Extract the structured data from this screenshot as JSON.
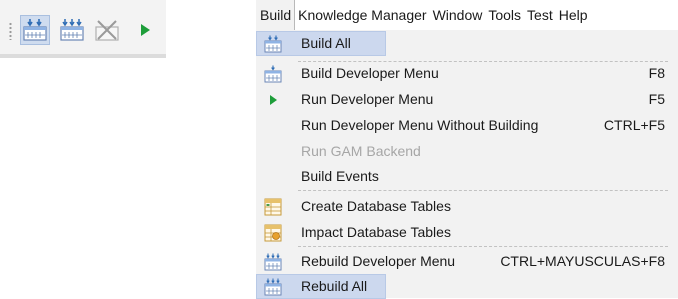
{
  "toolbar": {
    "buttons": [
      {
        "icon": "build-all-icon",
        "active": true
      },
      {
        "icon": "rebuild-all-icon",
        "active": false
      },
      {
        "icon": "cancel-build-icon",
        "active": false,
        "disabled": true
      },
      {
        "icon": "run-icon",
        "active": false
      }
    ]
  },
  "menubar": {
    "items": [
      "Build",
      "Knowledge Manager",
      "Window",
      "Tools",
      "Test",
      "Help"
    ]
  },
  "build_menu": {
    "items": [
      {
        "label": "Build All",
        "shortcut": "",
        "icon": "build-all-icon",
        "highlighted": true
      },
      {
        "label": "Build Developer Menu",
        "shortcut": "F8",
        "icon": "build-icon"
      },
      {
        "label": "Run Developer Menu",
        "shortcut": "F5",
        "icon": "run-icon"
      },
      {
        "label": "Run Developer Menu Without Building",
        "shortcut": "CTRL+F5",
        "icon": ""
      },
      {
        "label": "Run GAM Backend",
        "shortcut": "",
        "icon": "",
        "disabled": true
      },
      {
        "label": "Build Events",
        "shortcut": "",
        "icon": ""
      },
      {
        "label": "Create Database Tables",
        "shortcut": "",
        "icon": "create-tables-icon"
      },
      {
        "label": "Impact Database Tables",
        "shortcut": "",
        "icon": "impact-tables-icon"
      },
      {
        "label": "Rebuild Developer Menu",
        "shortcut": "CTRL+MAYUSCULAS+F8",
        "icon": "rebuild-icon"
      },
      {
        "label": "Rebuild All",
        "shortcut": "",
        "icon": "rebuild-all-icon",
        "highlighted": true
      }
    ]
  },
  "colors": {
    "highlight": "#ccd8ee",
    "run_green": "#1e9e3a",
    "icon_blue": "#2f6db5"
  }
}
